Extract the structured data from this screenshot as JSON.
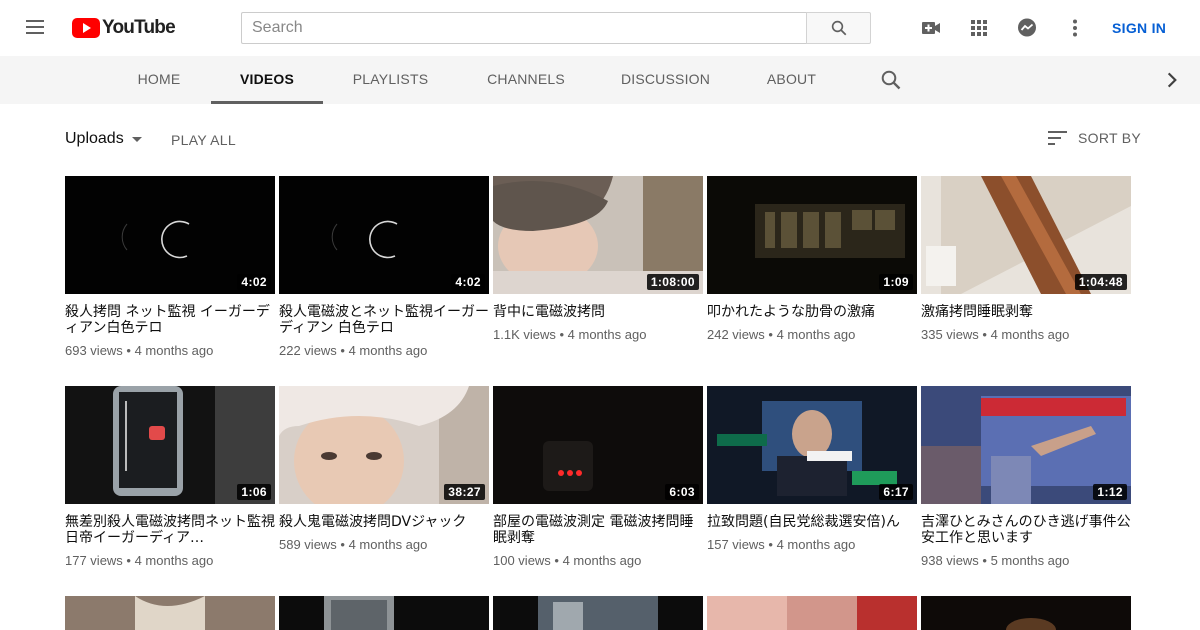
{
  "header": {
    "logo_text": "YouTube",
    "search_placeholder": "Search",
    "signin_label": "SIGN IN"
  },
  "tabs": [
    "HOME",
    "VIDEOS",
    "PLAYLISTS",
    "CHANNELS",
    "DISCUSSION",
    "ABOUT"
  ],
  "active_tab": "VIDEOS",
  "subbar": {
    "uploads_label": "Uploads",
    "play_all_label": "PLAY ALL",
    "sort_label": "SORT BY"
  },
  "videos": [
    {
      "title": "殺人拷問 ネット監視 イーガーディアン白色テロ",
      "duration": "4:02",
      "views": "693 views",
      "age": "4 months ago"
    },
    {
      "title": "殺人電磁波とネット監視イーガーディアン 白色テロ",
      "duration": "4:02",
      "views": "222 views",
      "age": "4 months ago"
    },
    {
      "title": "背中に電磁波拷問",
      "duration": "1:08:00",
      "views": "1.1K views",
      "age": "4 months ago"
    },
    {
      "title": "叩かれたような肋骨の激痛",
      "duration": "1:09",
      "views": "242 views",
      "age": "4 months ago"
    },
    {
      "title": "激痛拷問睡眠剥奪",
      "duration": "1:04:48",
      "views": "335 views",
      "age": "4 months ago"
    },
    {
      "title": "無差別殺人電磁波拷問ネット監視　日帝イーガーディア…",
      "duration": "1:06",
      "views": "177 views",
      "age": "4 months ago"
    },
    {
      "title": "殺人鬼電磁波拷問DVジャック",
      "duration": "38:27",
      "views": "589 views",
      "age": "4 months ago"
    },
    {
      "title": "部屋の電磁波測定 電磁波拷問睡眠剥奪",
      "duration": "6:03",
      "views": "100 views",
      "age": "4 months ago"
    },
    {
      "title": "拉致問題(自民党総裁選安倍)ん",
      "duration": "6:17",
      "views": "157 views",
      "age": "4 months ago"
    },
    {
      "title": "吉澤ひとみさんのひき逃げ事件公安工作と思います",
      "duration": "1:12",
      "views": "938 views",
      "age": "5 months ago"
    }
  ]
}
